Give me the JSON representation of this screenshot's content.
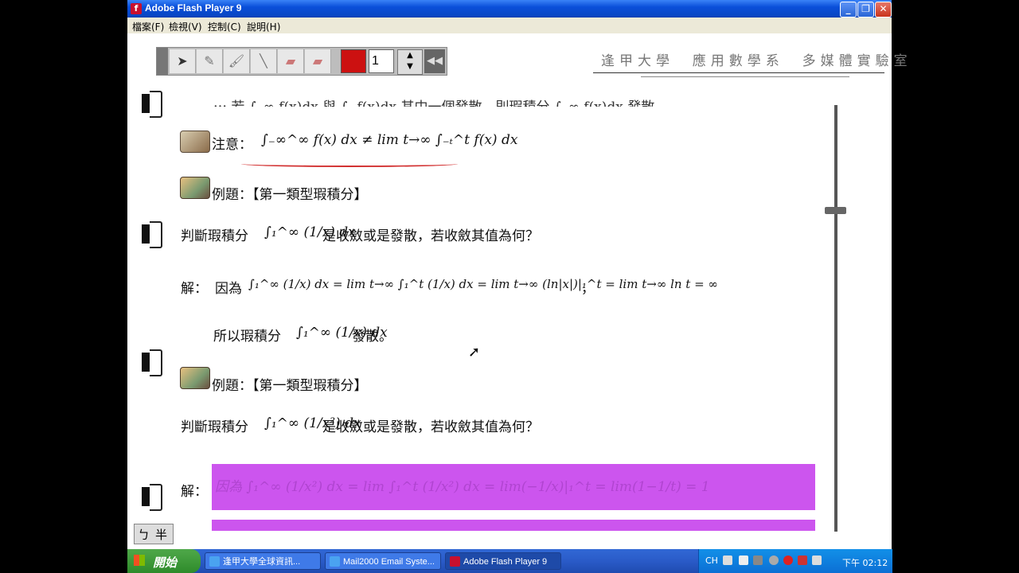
{
  "window": {
    "title": "Adobe Flash Player 9",
    "controls": {
      "minimize": "_",
      "maximize": "❐",
      "close": "✕"
    }
  },
  "menu": [
    "檔案(F)",
    "檢視(V)",
    "控制(C)",
    "說明(H)"
  ],
  "toolbar": {
    "tools": [
      "arrow-pointer",
      "pencil",
      "brush",
      "line",
      "eraser",
      "clear-eraser"
    ],
    "pen_color": "#cc1111",
    "pen_width": "1"
  },
  "header": {
    "lab": "逢甲大學  應用數學系  多媒體實驗室"
  },
  "lecture": {
    "partial_top": "⋯ 若 ∫₋∞ f(x)dx 與 ∫ₐ f(x)dx 其中一個發散，則瑕積分 ∫₋∞ f(x)dx 發散",
    "note_label": "注意：",
    "note_formula": "∫₋∞^∞ f(x) dx ≠ lim t→∞ ∫₋ₜ^t f(x) dx",
    "example1_title": "例題：【第一類型瑕積分】",
    "q1_prefix": "判斷瑕積分",
    "q1_formula": "∫₁^∞ (1/x) dx",
    "q1_suffix": "是收斂或是發散，若收斂其值為何？",
    "sol_label": "解：",
    "s1_prefix": "因為",
    "s1_formula": "∫₁^∞ (1/x) dx = lim t→∞ ∫₁^t (1/x) dx = lim t→∞ (ln|x|)|₁^t = lim t→∞ ln t = ∞",
    "s1_suffix": "，",
    "s1b_prefix": "所以瑕積分",
    "s1b_formula": "∫₁^∞ (1/x) dx",
    "s1b_suffix": "發散。",
    "example2_title": "例題：【第一類型瑕積分】",
    "q2_prefix": "判斷瑕積分",
    "q2_formula": "∫₁^∞ (1/x²) dx",
    "q2_suffix": "是收斂或是發散，若收斂其值為何？",
    "sol2_label": "解：",
    "s2_hidden": "因為 ∫₁^∞ (1/x²) dx = lim ∫₁^t (1/x²) dx = lim(−1/x)|₁^t = lim(1−1/t) = 1",
    "zhuyin": [
      "ㄅ",
      "半"
    ]
  },
  "taskbar": {
    "start": "開始",
    "tasks": [
      "逢甲大學全球資訊...",
      "Mail2000 Email Syste...",
      "Adobe Flash Player 9"
    ],
    "lang": "CH",
    "clock": "下午 02:12"
  }
}
